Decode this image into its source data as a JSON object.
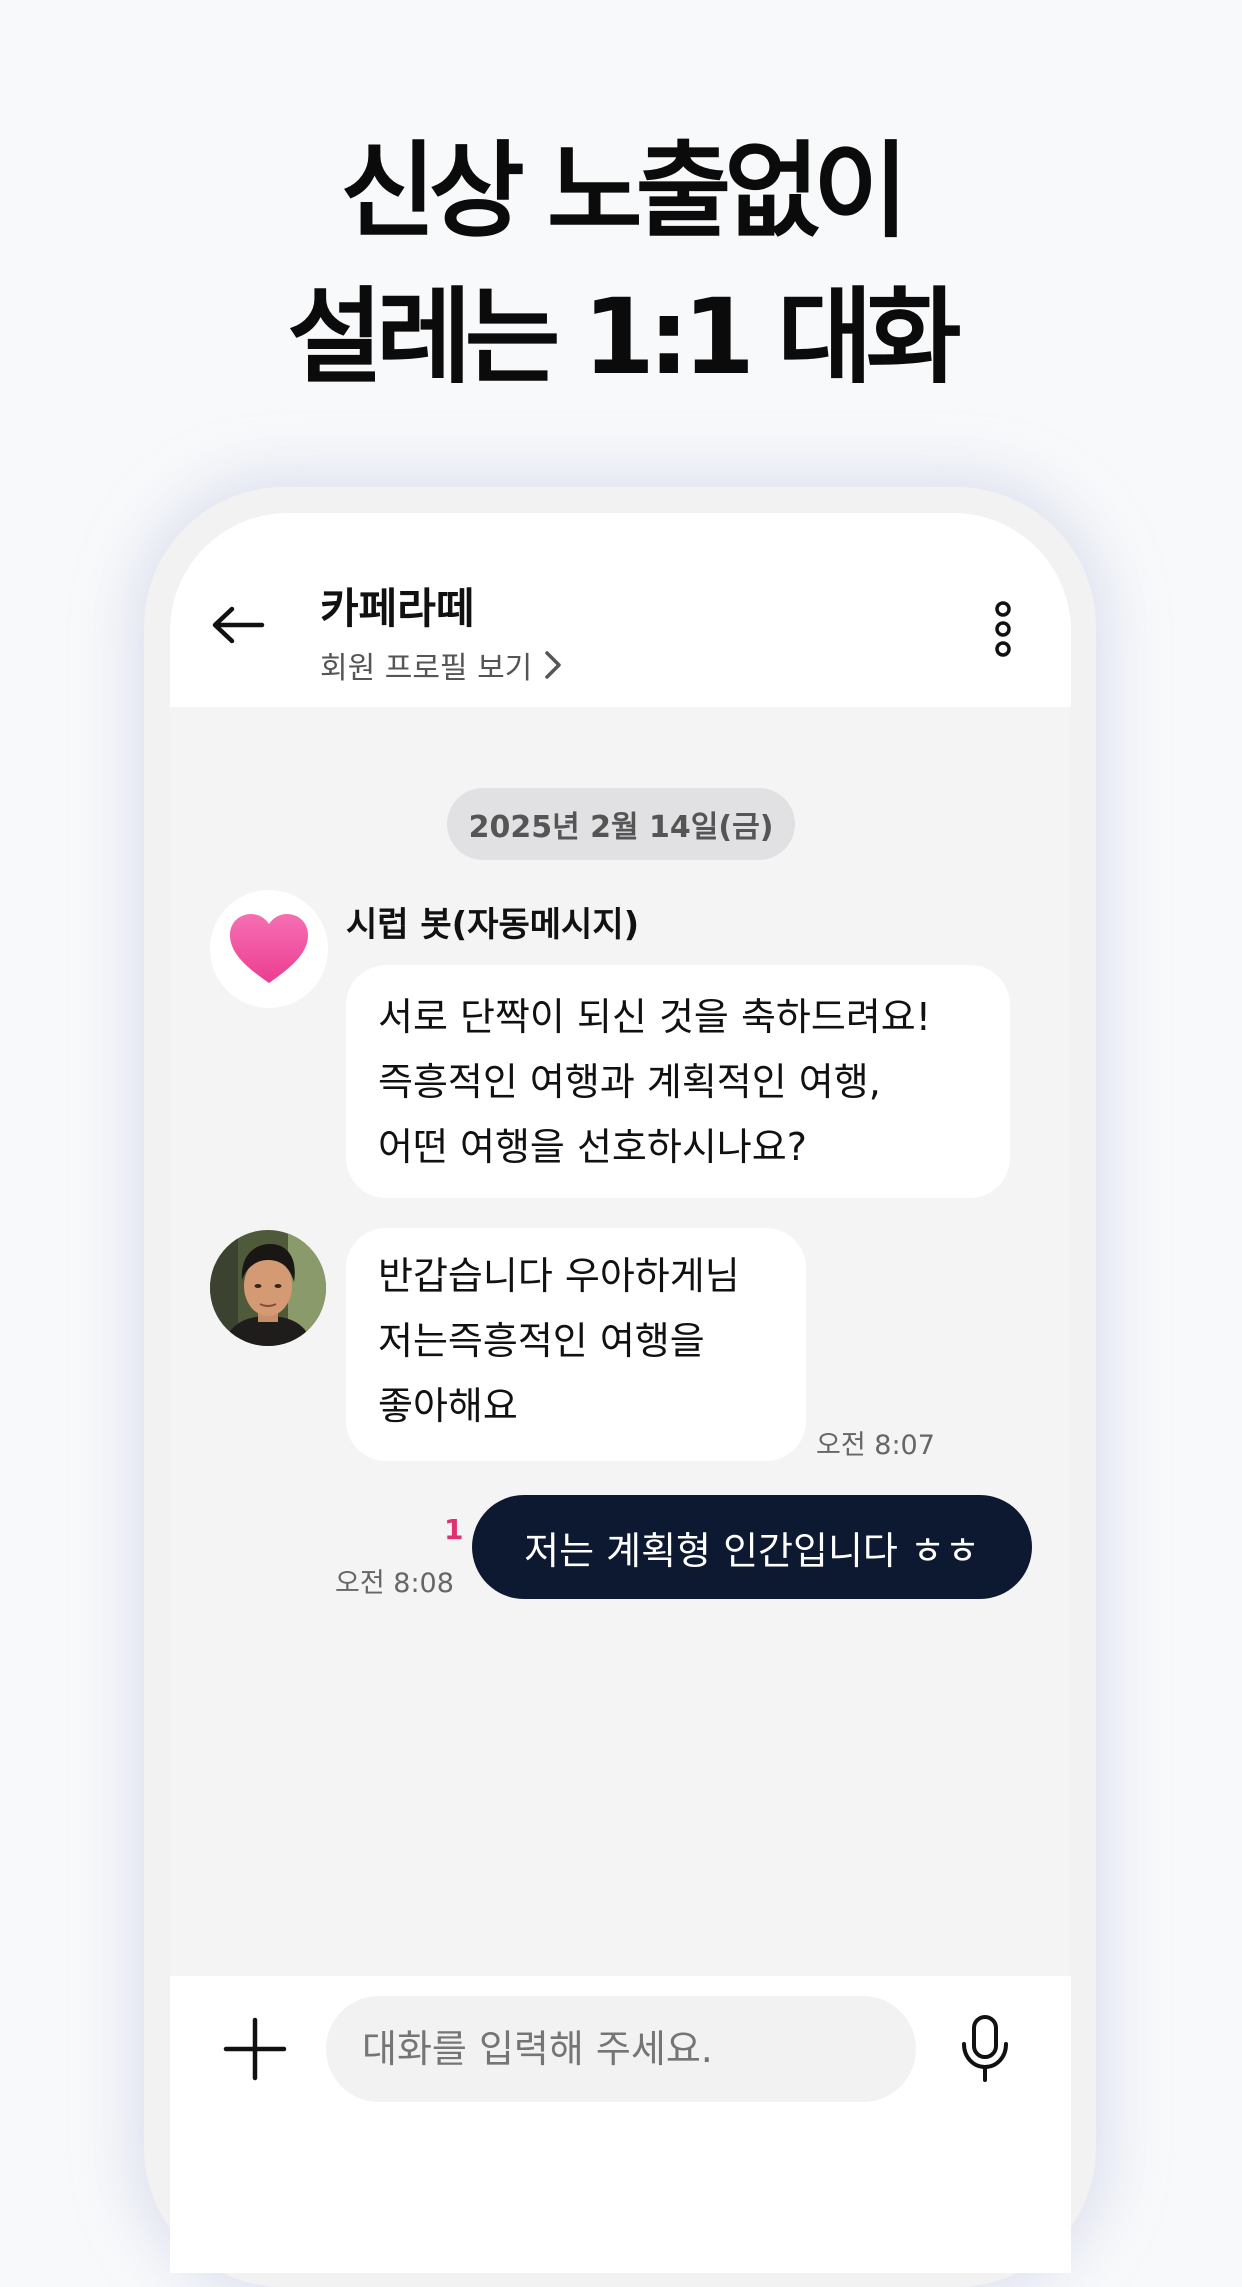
{
  "headline": {
    "line1": "신상 노출없이",
    "line2": "설레는 1:1 대화"
  },
  "header": {
    "title": "카페라떼",
    "profile_link": "회원 프로필 보기",
    "icons": {
      "back": "arrow-left-icon",
      "more": "more-vertical-icon",
      "chevron": "chevron-right-icon"
    }
  },
  "chat": {
    "date": "2025년 2월 14일(금)",
    "messages": [
      {
        "sender": "시럽 봇(자동메시지)",
        "avatar": "heart-icon",
        "lines": [
          "서로 단짝이 되신 것을 축하드려요!",
          "즉흥적인 여행과 계획적인 여행,",
          "어떤 여행을 선호하시나요?"
        ]
      },
      {
        "avatar": "user-photo",
        "lines": [
          "반갑습니다 우아하게님",
          "저는즉흥적인 여행을",
          "좋아해요"
        ],
        "time": "오전 8:07"
      },
      {
        "text": "저는 계획형 인간입니다 ㅎㅎ",
        "time": "오전 8:08",
        "unread_count": "1"
      }
    ]
  },
  "composer": {
    "placeholder": "대화를 입력해 주세요.",
    "icons": {
      "add": "plus-icon",
      "voice": "microphone-icon"
    }
  },
  "colors": {
    "page_bg": "#f8f9fb",
    "chat_bg": "#f4f4f5",
    "outgoing_bubble": "#0d1831",
    "unread_accent": "#e0306f",
    "heart": "#f0479a"
  }
}
